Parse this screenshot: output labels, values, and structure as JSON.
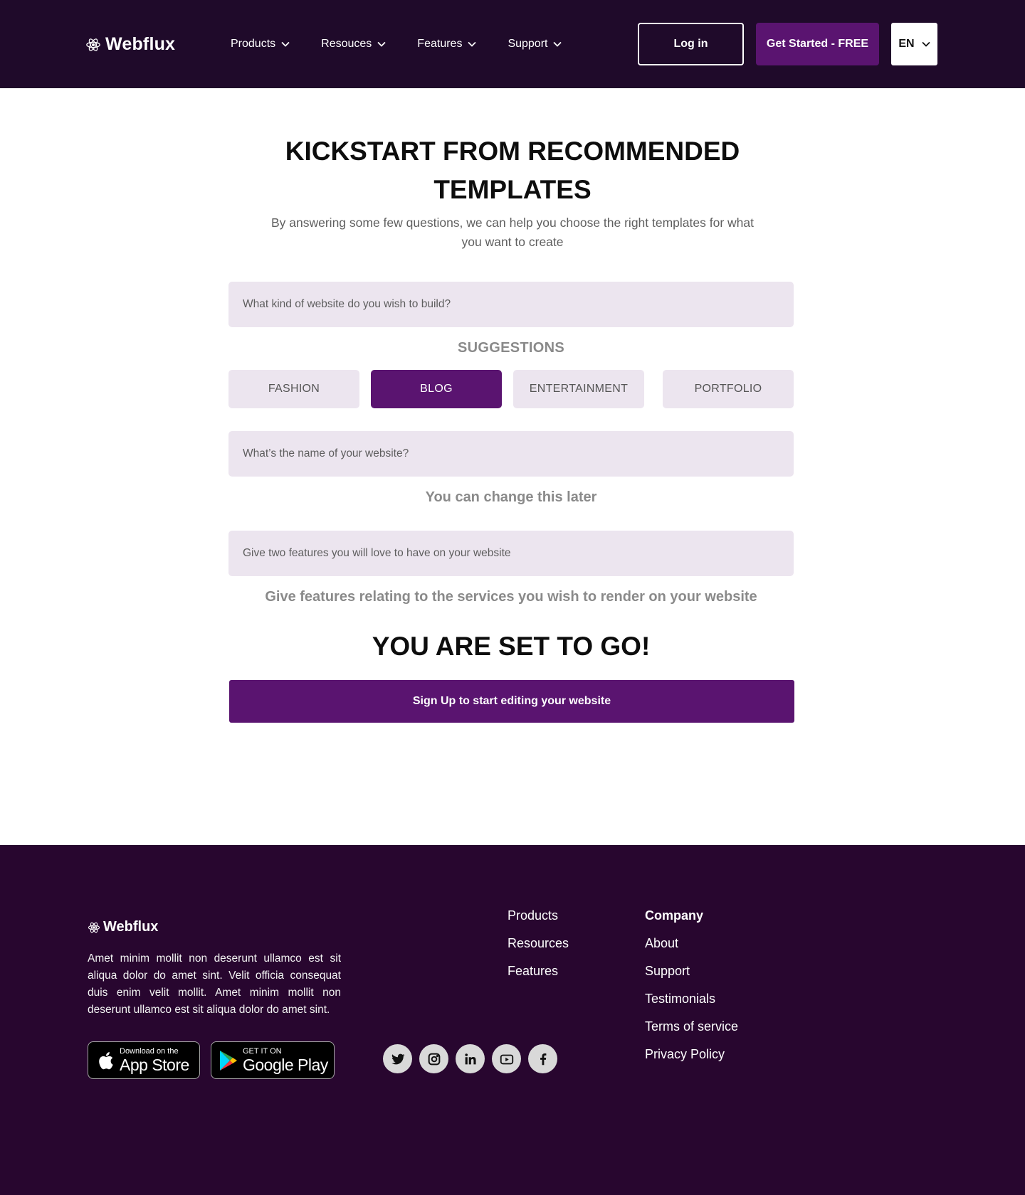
{
  "header": {
    "brand": "Webflux",
    "nav": [
      {
        "label": "Products"
      },
      {
        "label": "Resouces"
      },
      {
        "label": "Features"
      },
      {
        "label": "Support"
      }
    ],
    "login_label": "Log in",
    "get_started_label": "Get Started - FREE",
    "language": "EN"
  },
  "main": {
    "title": "KICKSTART FROM RECOMMENDED TEMPLATES",
    "subtitle": "By answering some few questions, we can help you choose the right templates for what you want to create",
    "website_kind_placeholder": "What kind of website do you wish to build?",
    "suggestions_label": "SUGGESTIONS",
    "suggestions": [
      {
        "label": "FASHION",
        "selected": false
      },
      {
        "label": "BLOG",
        "selected": true
      },
      {
        "label": "ENTERTAINMENT",
        "selected": false
      },
      {
        "label": "PORTFOLIO",
        "selected": false
      }
    ],
    "website_name_placeholder": "What’s the name of your website?",
    "website_name_hint": "You can change this later",
    "features_placeholder": "Give two features you will love to have on your website",
    "features_hint": "Give features relating to the services you wish to render on your website",
    "ready_heading": "YOU ARE SET TO GO!",
    "signup_label": "Sign Up to start editing your website"
  },
  "footer": {
    "brand": "Webflux",
    "description": "Amet minim mollit non deserunt ullamco est sit aliqua dolor do amet sint. Velit officia consequat duis enim velit mollit. Amet minim mollit non deserunt ullamco est sit aliqua dolor do amet sint.",
    "app_store": {
      "small": "Download on the",
      "big": "App Store"
    },
    "google_play": {
      "small": "GET IT ON",
      "big": "Google Play"
    },
    "socials": [
      "twitter-icon",
      "instagram-icon",
      "linkedin-icon",
      "youtube-icon",
      "facebook-icon"
    ],
    "links_col1": [
      "Products",
      "Resources",
      "Features"
    ],
    "company_heading": "Company",
    "links_col2": [
      "About",
      "Support",
      "Testimonials",
      "Terms of service",
      "Privacy Policy"
    ]
  },
  "colors": {
    "header_bg": "#1f0a2a",
    "footer_bg": "#28062f",
    "accent": "#5a1470",
    "field_bg": "#ece5ef"
  }
}
